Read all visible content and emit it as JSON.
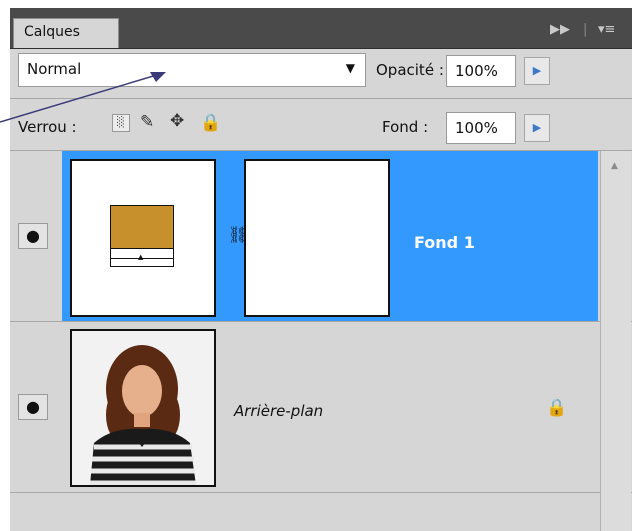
{
  "panel": {
    "tab_label": "Calques",
    "collapse_icon": "double-chevron-right-icon",
    "menu_icon": "panel-menu-icon"
  },
  "blend": {
    "mode": "Normal",
    "opacity_label": "Opacité :",
    "opacity_value": "100%"
  },
  "lock": {
    "label": "Verrou :",
    "fill_label": "Fond :",
    "fill_value": "100%"
  },
  "layers": [
    {
      "name": "Fond 1",
      "visible": true,
      "selected": true,
      "fill_color": "#c8902c"
    },
    {
      "name": "Arrière-plan",
      "visible": true,
      "selected": false,
      "locked": true
    }
  ],
  "colors": {
    "selection": "#3399ff",
    "panel": "#d6d6d6",
    "header": "#4a4a4a"
  }
}
